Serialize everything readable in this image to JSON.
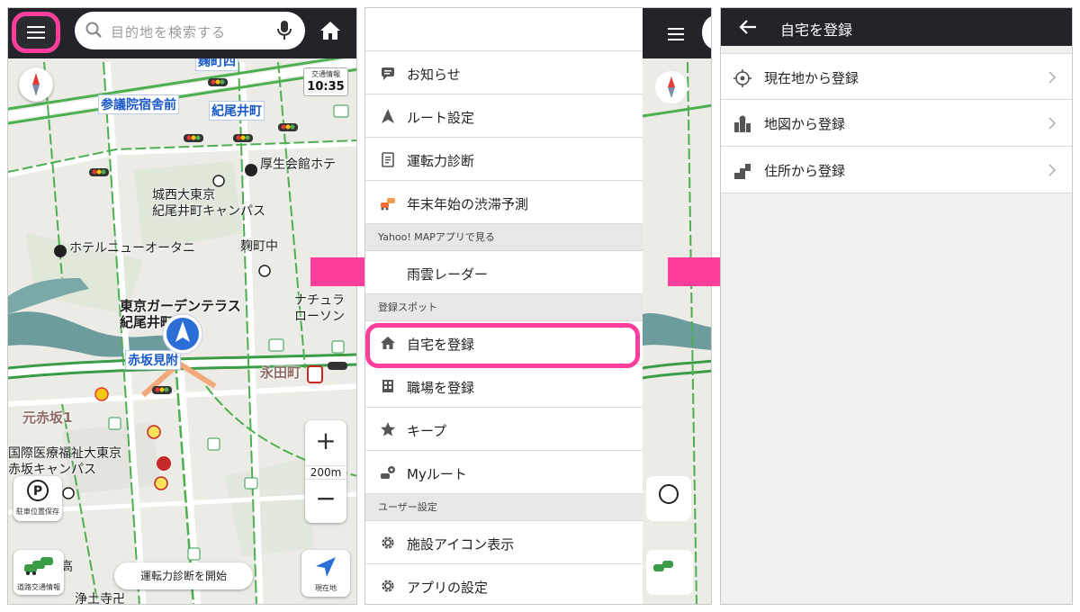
{
  "map_screen": {
    "search_placeholder": "目的地を検索する",
    "traffic_info_label": "交通情報",
    "clock": "10:35",
    "scale": "200m",
    "zoom_in": "+",
    "zoom_out": "−",
    "parking_label": "駐車位置保存",
    "road_traffic_label": "道路交通情報",
    "current_location_label": "現在地",
    "start_diagnosis": "運転力診断を開始",
    "labels": [
      {
        "key": "kojimachi4",
        "text": "麹町四"
      },
      {
        "key": "sangiin",
        "text": "参議院宿舎前"
      },
      {
        "key": "kioicho",
        "text": "紀尾井町"
      },
      {
        "key": "kosei",
        "text": "厚生会館ホテ"
      },
      {
        "key": "josai1",
        "text": "城西大東京"
      },
      {
        "key": "josai2",
        "text": "紀尾井町キャンパス"
      },
      {
        "key": "newotani",
        "text": "ホテルニューオータニ"
      },
      {
        "key": "kojimachi_jhs",
        "text": "麹町中"
      },
      {
        "key": "garden1",
        "text": "東京ガーデンテラス"
      },
      {
        "key": "garden2",
        "text": "紀尾井町"
      },
      {
        "key": "natural1",
        "text": "ナチュラ"
      },
      {
        "key": "natural2",
        "text": "ローソン"
      },
      {
        "key": "akasaka_mitsuke",
        "text": "赤坂見附"
      },
      {
        "key": "nagatacho",
        "text": "永田町"
      },
      {
        "key": "motoakasaka",
        "text": "元赤坂1"
      },
      {
        "key": "iryo1",
        "text": "国際医療福祉大東京"
      },
      {
        "key": "iryo2",
        "text": "赤坂キャンパス"
      },
      {
        "key": "kou",
        "text": "高"
      },
      {
        "key": "jodoji",
        "text": "浄土寺卍"
      }
    ]
  },
  "menu": {
    "items_top": [
      {
        "label": "お知らせ",
        "icon": "message-icon"
      },
      {
        "label": "ルート設定",
        "icon": "navigation-arrow-icon"
      },
      {
        "label": "運転力診断",
        "icon": "clipboard-icon"
      },
      {
        "label": "年末年始の渋滞予測",
        "icon": "traffic-jam-icon"
      }
    ],
    "section_yahoo": "Yahoo! MAPアプリで見る",
    "item_rain": "雨雲レーダー",
    "section_spots": "登録スポット",
    "items_spots": [
      {
        "label": "自宅を登録",
        "icon": "home-icon"
      },
      {
        "label": "職場を登録",
        "icon": "building-icon"
      },
      {
        "label": "キープ",
        "icon": "star-icon"
      },
      {
        "label": "Myルート",
        "icon": "my-route-icon"
      }
    ],
    "section_user": "ユーザー設定",
    "items_user": [
      {
        "label": "施設アイコン表示",
        "icon": "gear-icon"
      },
      {
        "label": "アプリの設定",
        "icon": "gear-icon"
      }
    ]
  },
  "register": {
    "title": "自宅を登録",
    "options": [
      {
        "label": "現在地から登録",
        "icon": "current-location-icon"
      },
      {
        "label": "地図から登録",
        "icon": "map-pin-icon"
      },
      {
        "label": "住所から登録",
        "icon": "address-icon"
      }
    ]
  },
  "colors": {
    "accent_pink": "#ff3d9a",
    "header_dark": "#222429",
    "map_bg": "#eeece7",
    "road_green": "#4caf50",
    "label_blue": "#1959c9"
  }
}
